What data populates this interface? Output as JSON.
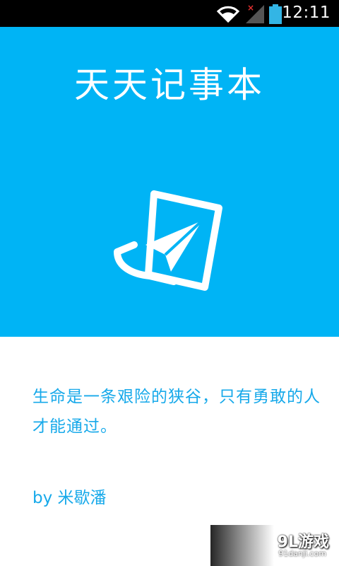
{
  "status_bar": {
    "time": "12:11",
    "icons": [
      "wifi-icon",
      "signal-icon",
      "battery-icon"
    ]
  },
  "splash": {
    "title": "天天记事本",
    "logo_icon": "paper-plane-note-icon",
    "background_color": "#00b4f5"
  },
  "quote": {
    "text": "生命是一条艰险的狭谷，只有勇敢的人才能通过。",
    "author": "by 米歇潘",
    "color": "#17a9ea"
  },
  "watermark": {
    "logo": "9L游戏",
    "url": "91danji.com"
  }
}
